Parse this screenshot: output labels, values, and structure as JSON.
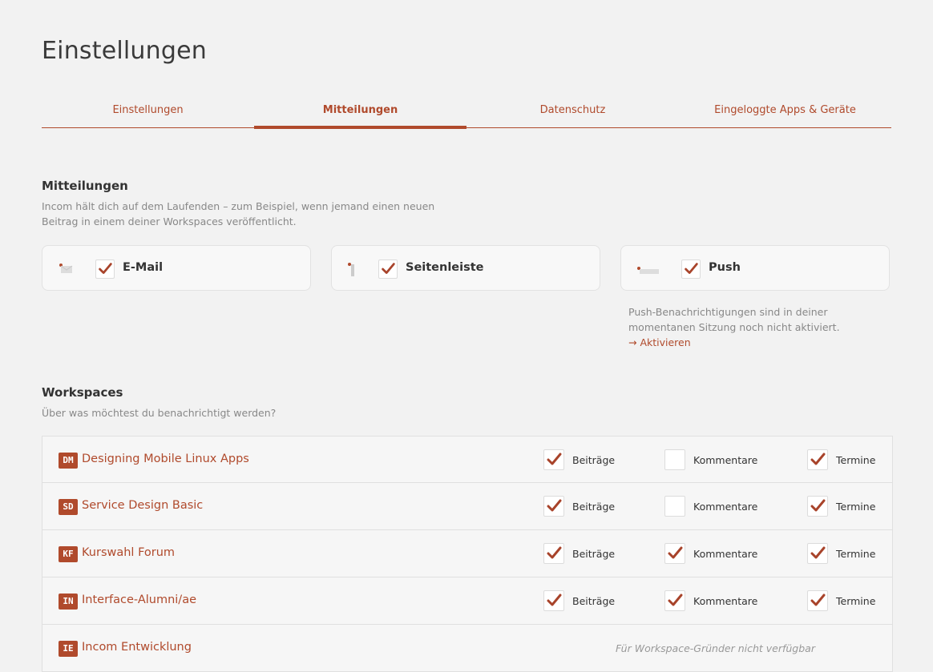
{
  "page": {
    "title": "Einstellungen"
  },
  "tabs": [
    {
      "label": "Einstellungen",
      "active": false
    },
    {
      "label": "Mitteilungen",
      "active": true
    },
    {
      "label": "Datenschutz",
      "active": false
    },
    {
      "label": "Eingeloggte Apps & Geräte",
      "active": false
    }
  ],
  "notifications": {
    "title": "Mitteilungen",
    "description_line1": "Incom hält dich auf dem Laufenden – zum Beispiel, wenn jemand einen neuen",
    "description_line2": "Beitrag in einem deiner Workspaces veröffentlicht.",
    "channels": [
      {
        "label": "E-Mail",
        "checked": true,
        "icon": "mail-icon"
      },
      {
        "label": "Seitenleiste",
        "checked": true,
        "icon": "sidebar-icon"
      },
      {
        "label": "Push",
        "checked": true,
        "icon": "push-icon"
      }
    ],
    "push_note_line1": "Push-Benachrichtigungen sind in deiner",
    "push_note_line2": "momentanen Sitzung noch nicht aktiviert.",
    "push_activate": "→ Aktivieren"
  },
  "workspaces": {
    "title": "Workspaces",
    "description": "Über was möchtest du benachrichtigt werden?",
    "option_labels": {
      "posts": "Beiträge",
      "comments": "Kommentare",
      "events": "Termine"
    },
    "unavailable_text": "Für Workspace-Gründer nicht verfügbar",
    "rows": [
      {
        "badge": "DM",
        "name": "Designing Mobile Linux Apps",
        "posts": true,
        "comments": false,
        "events": true
      },
      {
        "badge": "SD",
        "name": "Service Design Basic",
        "posts": true,
        "comments": false,
        "events": true
      },
      {
        "badge": "KF",
        "name": "Kurswahl Forum",
        "posts": true,
        "comments": true,
        "events": true
      },
      {
        "badge": "IN",
        "name": "Interface-Alumni/ae",
        "posts": true,
        "comments": true,
        "events": true
      },
      {
        "badge": "IE",
        "name": "Incom Entwicklung",
        "founder": true
      }
    ]
  },
  "colors": {
    "accent": "#b04a2c",
    "background": "#f2f2f2",
    "muted": "#888888"
  }
}
